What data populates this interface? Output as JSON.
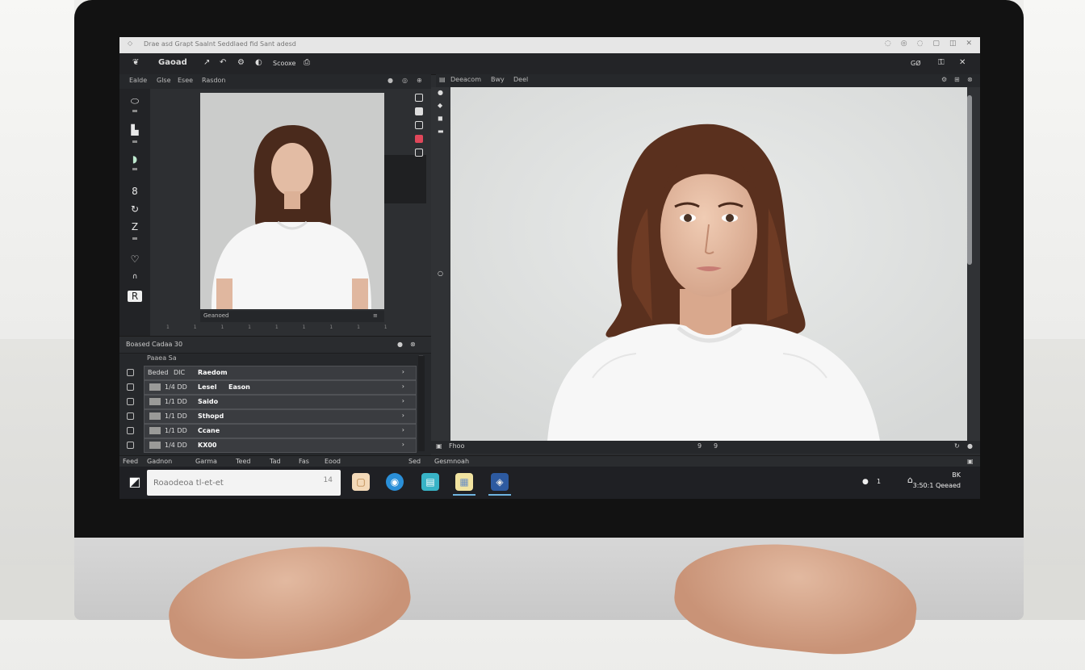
{
  "window": {
    "title": "Drae asd Grapt Saalnt Seddlaed fid   Sant adesd",
    "controls": [
      "restore-icon",
      "minimize-icon",
      "maximize-icon",
      "close-icon"
    ]
  },
  "menubar": {
    "app_name": "Gaoad",
    "tools": [
      "share-icon",
      "undo-icon",
      "settings-icon",
      "adjust-icon",
      "save-icon"
    ],
    "tool_label": "Scooxe",
    "right_label": "GØ"
  },
  "left_panel": {
    "tabs": [
      "Ealde",
      "Glse",
      "Esee",
      "Rasdon"
    ],
    "thumbnail_caption": "Geanoed",
    "ruler": "1 1 1 1 1 1 1 1 1"
  },
  "layers": {
    "title": "Boased Cadaa 30",
    "sub_header": "Paaea   Sa",
    "rows": [
      {
        "a": "Beded",
        "b": "DIC",
        "name": "Raedom"
      },
      {
        "a": "1/4 DD",
        "b": "Lesel",
        "name": "Eason"
      },
      {
        "a": "1/1 DD",
        "b": "",
        "name": "Saido"
      },
      {
        "a": "1/1 DD",
        "b": "",
        "name": "Sthopd"
      },
      {
        "a": "1/1 DD",
        "b": "",
        "name": "Ccane"
      },
      {
        "a": "1/4 DD",
        "b": "",
        "name": "KX00"
      }
    ]
  },
  "right_panel": {
    "tabs": [
      "Deeacom",
      "Bwy",
      "Deel"
    ],
    "footer_label": "Fhoo",
    "zoom_left": "9",
    "zoom_right": "9"
  },
  "status_bar": {
    "items": [
      "Feed",
      "Gadnon",
      "Garma",
      "Teed",
      "Tad",
      "Fas",
      "Eood",
      "Sed",
      "Gesmnoah"
    ]
  },
  "taskbar": {
    "search_placeholder": "Roaodeoa tl-et-et",
    "search_shortcut": "14",
    "apps": [
      "notes-app-icon",
      "browser-app-icon",
      "store-app-icon",
      "files-app-icon",
      "editor-app-icon"
    ],
    "tray_labels": [
      "BK",
      "1"
    ],
    "time": "3:50:1",
    "date": "Qeeaed"
  },
  "colors": {
    "accent": "#6fb4e0",
    "panel": "#2b2d30",
    "canvas": "#dfe1e0"
  }
}
